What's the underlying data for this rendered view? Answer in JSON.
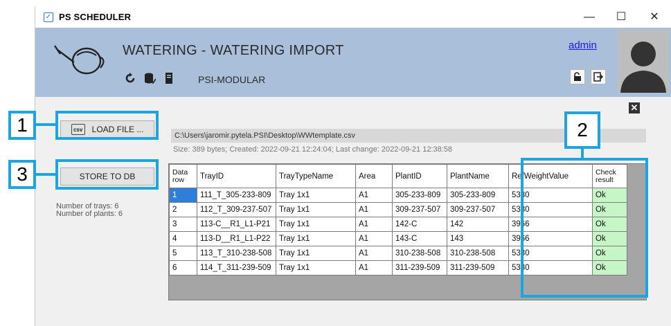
{
  "window": {
    "title": "PS SCHEDULER",
    "minimize": "—",
    "maximize": "☐",
    "close": "✕"
  },
  "header": {
    "title": "WATERING - WATERING IMPORT",
    "subtitle": "PSI-MODULAR",
    "user": "admin",
    "icons": [
      "watering-can-icon",
      "refresh-icon",
      "database-icon",
      "server-icon",
      "unlock-icon",
      "logout-icon",
      "avatar"
    ]
  },
  "actions": {
    "load_label": "LOAD FILE ...",
    "csv_icon": "csv",
    "store_label": "STORE TO DB"
  },
  "summary": {
    "trays": "Number of trays: 6",
    "plants": "Number of plants: 6"
  },
  "file": {
    "path": "C:\\Users\\jaromir.pytela.PSI\\Desktop\\WWtemplate.csv",
    "meta": "Size: 389 bytes;   Created: 2022-09-21  12:24:04;   Last change: 2022-09-21  12:38:58"
  },
  "table": {
    "columns": [
      "Data row",
      "TrayID",
      "TrayTypeName",
      "Area",
      "PlantID",
      "PlantName",
      "RefWeightValue",
      "Check result"
    ],
    "rows": [
      [
        "1",
        "111_T_305-233-809",
        "Tray 1x1",
        "A1",
        "305-233-809",
        "305-233-809",
        "5330",
        "Ok"
      ],
      [
        "2",
        "112_T_309-237-507",
        "Tray 1x1",
        "A1",
        "309-237-507",
        "309-237-507",
        "5330",
        "Ok"
      ],
      [
        "3",
        "113-C__R1_L1-P21",
        "Tray 1x1",
        "A1",
        "142-C",
        "142",
        "3966",
        "Ok"
      ],
      [
        "4",
        "113-D__R1_L1-P22",
        "Tray 1x1",
        "A1",
        "143-C",
        "143",
        "3966",
        "Ok"
      ],
      [
        "5",
        "113_T_310-238-508",
        "Tray 1x1",
        "A1",
        "310-238-508",
        "310-238-508",
        "5330",
        "Ok"
      ],
      [
        "6",
        "114_T_311-239-509",
        "Tray 1x1",
        "A1",
        "311-239-509",
        "311-239-509",
        "5330",
        "Ok"
      ]
    ]
  },
  "annotations": {
    "label_1": "1",
    "label_2": "2",
    "label_3": "3",
    "panel_close": "✕",
    "color": "#1ea5e0"
  }
}
